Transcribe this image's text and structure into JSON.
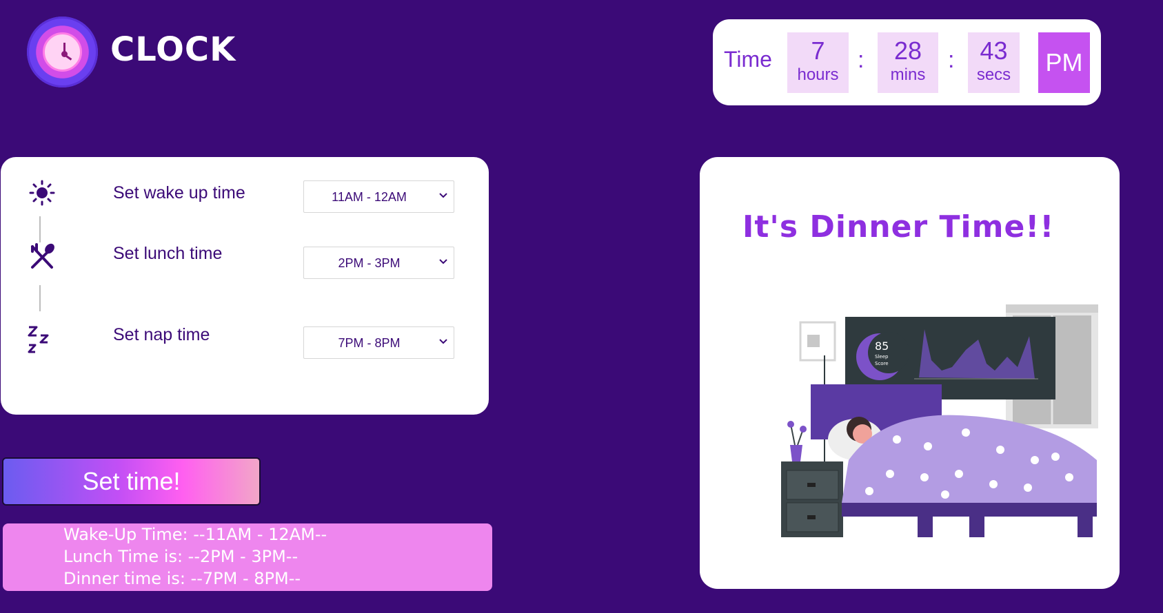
{
  "brand": {
    "name": "CLOCK",
    "icon": "clock-icon"
  },
  "clock": {
    "label": "Time",
    "hours": "7",
    "hours_unit": "hours",
    "mins": "28",
    "mins_unit": "mins",
    "secs": "43",
    "secs_unit": "secs",
    "separator": ":",
    "ampm": "PM"
  },
  "settings": {
    "rows": [
      {
        "icon": "sun-icon",
        "label": "Set wake up time",
        "value": "11AM - 12AM"
      },
      {
        "icon": "utensils-icon",
        "label": "Set lunch time",
        "value": "2PM - 3PM"
      },
      {
        "icon": "zzz-icon",
        "label": "Set nap time",
        "value": "7PM - 8PM"
      }
    ]
  },
  "set_button": {
    "label": "Set time!"
  },
  "summary": {
    "wake": "Wake-Up Time: --11AM - 12AM--",
    "lunch": "Lunch Time is: --2PM - 3PM--",
    "dinner": "Dinner time is: --7PM - 8PM--"
  },
  "message": {
    "title": "It's Dinner Time!!",
    "illustration": "sleeping-person-illustration",
    "sleep_score": "85",
    "sleep_score_label1": "Sleep",
    "sleep_score_label2": "Score"
  },
  "colors": {
    "background": "#3b0a77",
    "accent": "#7a2cd0",
    "ampm": "#c552f0",
    "summary": "#ee86ee"
  }
}
